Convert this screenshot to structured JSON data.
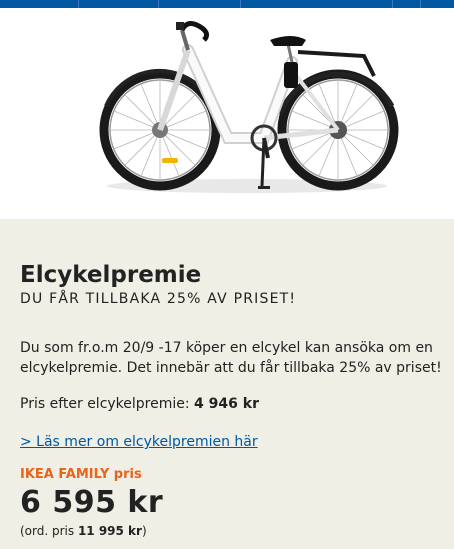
{
  "colors": {
    "accent": "#0058a3",
    "family": "#e8641b",
    "background": "#efefe6"
  },
  "promo": {
    "title": "Elcykelpremie",
    "subtitle": "DU FÅR TILLBAKA 25% AV PRISET!",
    "description": "Du som fr.o.m 20/9 -17 köper en elcykel kan ansöka om en elcykelpremie. Det innebär att du får tillbaka 25% av priset!",
    "after_price_label": "Pris efter elcykelpremie:",
    "after_price_value": "4 946 kr",
    "read_more_link": "> Läs mer om elcykelpremien här",
    "family_label": "IKEA FAMILY pris",
    "price": "6 595 kr",
    "ord_prefix": "(ord. pris",
    "ord_value": "11 995 kr",
    "ord_suffix": ")"
  }
}
